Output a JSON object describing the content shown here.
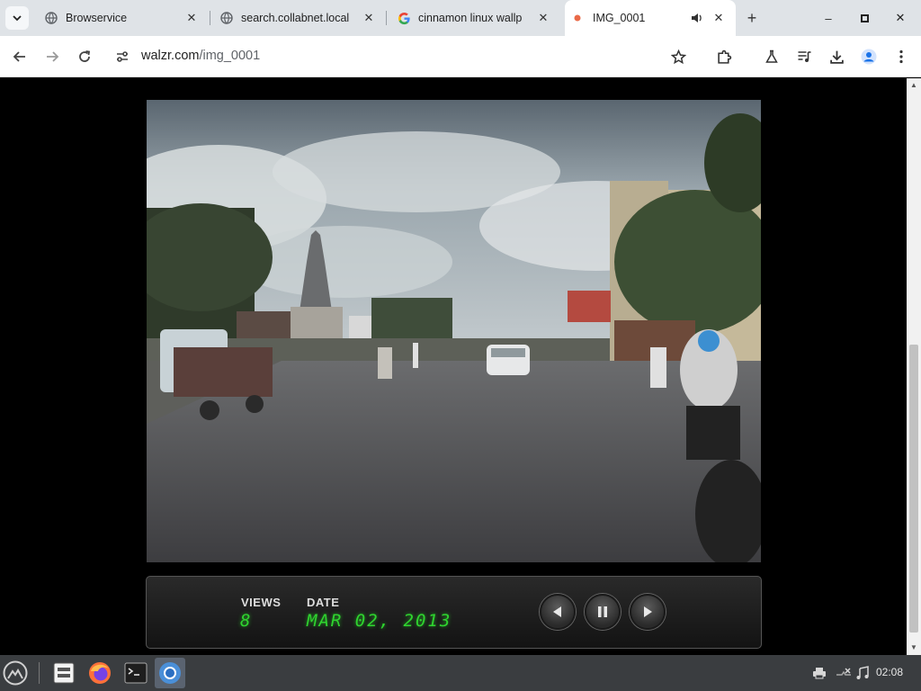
{
  "browser": {
    "tabs": [
      {
        "title": "Browservice",
        "icon": "globe-icon"
      },
      {
        "title": "search.collabnet.local",
        "icon": "globe-icon"
      },
      {
        "title": "cinnamon linux wallp",
        "icon": "google-icon"
      },
      {
        "title": "IMG_0001",
        "icon": "recording-dot-icon",
        "audio": true,
        "active": true
      }
    ],
    "new_tab": "+",
    "window": {
      "minimize": "–",
      "maximize": "▫",
      "close": "✕"
    },
    "address": {
      "domain": "walzr.com",
      "path": "/img_0001"
    }
  },
  "viewer": {
    "views_label": "VIEWS",
    "views_value": "8",
    "date_label": "DATE",
    "date_value": "MAR 02, 2013"
  },
  "taskbar": {
    "apps": [
      "menu-icon",
      "files-icon",
      "firefox-icon",
      "terminal-icon",
      "chromium-icon"
    ],
    "clock": "02:08"
  }
}
